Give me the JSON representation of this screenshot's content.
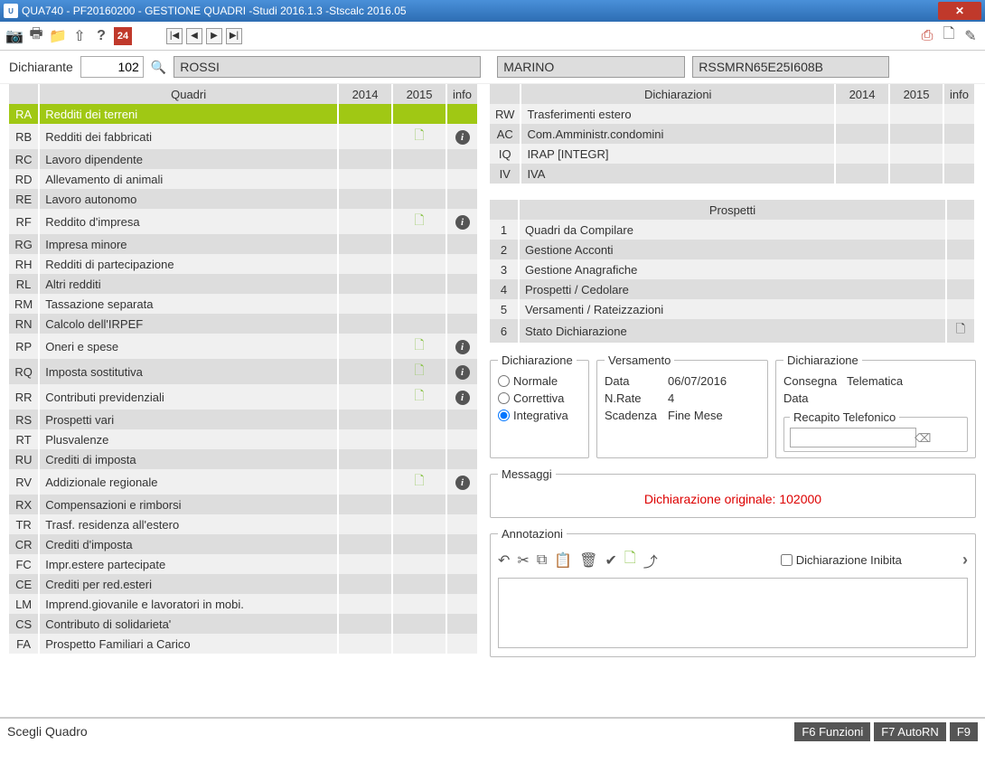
{
  "titlebar": "QUA740  - PF20160200 -  GESTIONE QUADRI  -Studi 2016.1.3  -Stscalc 2016.05",
  "toolbar": {
    "badge": "24"
  },
  "dichiarante": {
    "label": "Dichiarante",
    "code": "102",
    "surname": "ROSSI",
    "name": "MARINO",
    "cf": "RSSMRN65E25I608B"
  },
  "quadri": {
    "headers": {
      "main": "Quadri",
      "y1": "2014",
      "y2": "2015",
      "info": "info"
    },
    "rows": [
      {
        "code": "RA",
        "label": "Redditi dei terreni",
        "selected": true
      },
      {
        "code": "RB",
        "label": "Redditi dei fabbricati",
        "y2doc": true,
        "info": true
      },
      {
        "code": "RC",
        "label": "Lavoro dipendente"
      },
      {
        "code": "RD",
        "label": "Allevamento di animali"
      },
      {
        "code": "RE",
        "label": "Lavoro autonomo"
      },
      {
        "code": "RF",
        "label": "Reddito d'impresa",
        "y2doc": true,
        "info": true
      },
      {
        "code": "RG",
        "label": "Impresa minore"
      },
      {
        "code": "RH",
        "label": "Redditi di partecipazione"
      },
      {
        "code": "RL",
        "label": "Altri redditi"
      },
      {
        "code": "RM",
        "label": "Tassazione separata"
      },
      {
        "code": "RN",
        "label": "Calcolo dell'IRPEF"
      },
      {
        "code": "RP",
        "label": "Oneri e spese",
        "y2doc": true,
        "info": true
      },
      {
        "code": "RQ",
        "label": "Imposta sostitutiva",
        "y2doc": true,
        "info": true
      },
      {
        "code": "RR",
        "label": "Contributi previdenziali",
        "y2doc": true,
        "info": true
      },
      {
        "code": "RS",
        "label": "Prospetti vari"
      },
      {
        "code": "RT",
        "label": "Plusvalenze"
      },
      {
        "code": "RU",
        "label": "Crediti di imposta"
      },
      {
        "code": "RV",
        "label": "Addizionale regionale",
        "y2doc": true,
        "info": true
      },
      {
        "code": "RX",
        "label": "Compensazioni e rimborsi"
      },
      {
        "code": "TR",
        "label": "Trasf. residenza all'estero"
      },
      {
        "code": "CR",
        "label": "Crediti d'imposta"
      },
      {
        "code": "FC",
        "label": "Impr.estere partecipate"
      },
      {
        "code": "CE",
        "label": "Crediti per red.esteri"
      },
      {
        "code": "LM",
        "label": "Imprend.giovanile e lavoratori in mobi."
      },
      {
        "code": "CS",
        "label": "Contributo di solidarieta'"
      },
      {
        "code": "FA",
        "label": "Prospetto Familiari a Carico"
      }
    ]
  },
  "dichiarazioni": {
    "headers": {
      "main": "Dichiarazioni",
      "y1": "2014",
      "y2": "2015",
      "info": "info"
    },
    "rows": [
      {
        "code": "RW",
        "label": "Trasferimenti estero"
      },
      {
        "code": "AC",
        "label": "Com.Amministr.condomini"
      },
      {
        "code": "IQ",
        "label": "IRAP  [INTEGR]"
      },
      {
        "code": "IV",
        "label": "IVA"
      }
    ]
  },
  "prospetti": {
    "header": "Prospetti",
    "rows": [
      {
        "n": "1",
        "label": "Quadri da Compilare"
      },
      {
        "n": "2",
        "label": "Gestione Acconti"
      },
      {
        "n": "3",
        "label": "Gestione Anagrafiche"
      },
      {
        "n": "4",
        "label": "Prospetti / Cedolare"
      },
      {
        "n": "5",
        "label": "Versamenti / Rateizzazioni"
      },
      {
        "n": "6",
        "label": "Stato Dichiarazione",
        "doc": true
      }
    ]
  },
  "dich_type": {
    "legend": "Dichiarazione",
    "options": {
      "normale": "Normale",
      "correttiva": "Correttiva",
      "integrativa": "Integrativa"
    },
    "selected": "integrativa"
  },
  "versamento": {
    "legend": "Versamento",
    "data_k": "Data",
    "data_v": "06/07/2016",
    "rate_k": "N.Rate",
    "rate_v": "4",
    "scad_k": "Scadenza",
    "scad_v": "Fine Mese"
  },
  "consegna": {
    "legend": "Dichiarazione",
    "line1a": "Consegna",
    "line1b": "Telematica",
    "line2": "Data",
    "recapito_legend": "Recapito Telefonico"
  },
  "messaggi": {
    "legend": "Messaggi",
    "text": "Dichiarazione originale: 102000"
  },
  "annotazioni": {
    "legend": "Annotazioni",
    "inibita_label": "Dichiarazione Inibita"
  },
  "statusbar": {
    "text": "Scegli Quadro",
    "btn1": "F6 Funzioni",
    "btn2": "F7 AutoRN",
    "btn3": "F9"
  }
}
